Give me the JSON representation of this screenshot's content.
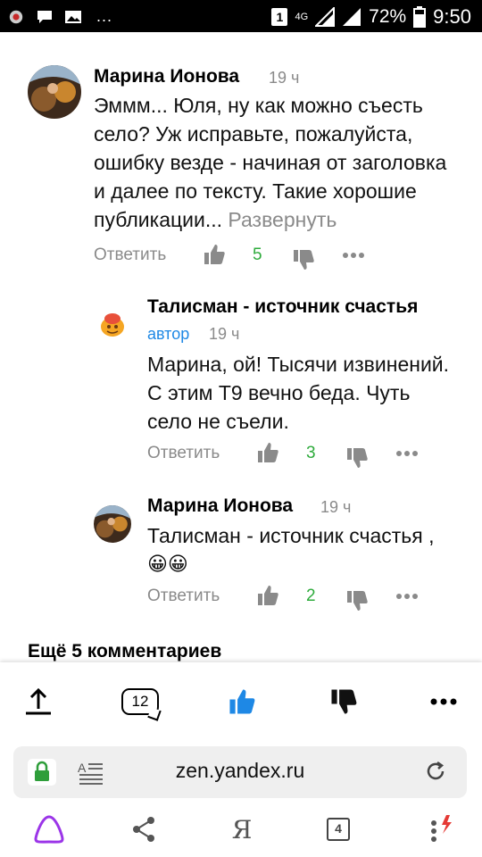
{
  "status": {
    "sim": "1",
    "network": "4G",
    "battery": "72%",
    "time": "9:50",
    "dots": "..."
  },
  "comments": [
    {
      "name": "Марина Ионова",
      "time": "19 ч",
      "text": "Эммм... Юля, ну как можно съесть село? Уж исправьте, пожалуйста, ошибку везде - начиная от заголовка и далее по тексту. Такие хорошие публикации...",
      "expand": "Развернуть",
      "reply": "Ответить",
      "likes": "5"
    },
    {
      "name": "Талисман - источник счастья",
      "author": "автор",
      "time": "19 ч",
      "text": "Марина, ой! Тысячи извинений. С этим Т9 вечно беда. Чуть село не съели.",
      "reply": "Ответить",
      "likes": "3"
    },
    {
      "name": "Марина Ионова",
      "time": "19 ч",
      "text": "Талисман - источник счастья ,",
      "emoji": "😀😀",
      "reply": "Ответить",
      "likes": "2"
    }
  ],
  "more_comments": "Ещё 5 комментариев",
  "toolbar": {
    "comments_count": "12",
    "like_color": "#1e88e5"
  },
  "browser": {
    "url": "zen.yandex.ru",
    "lock_color": "#2e9e3a"
  },
  "navbar": {
    "yandex_letter": "Я",
    "tabs_count": "4"
  }
}
